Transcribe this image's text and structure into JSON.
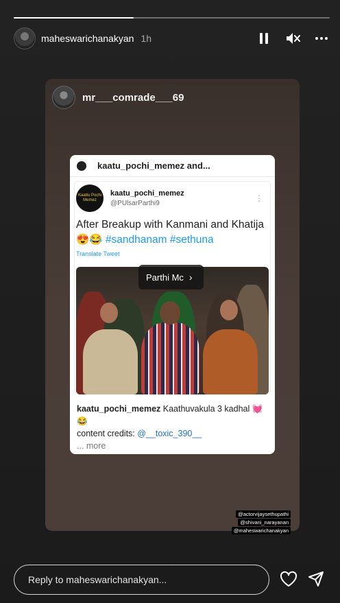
{
  "story": {
    "progress": 0.38,
    "username": "maheswarichanakyan",
    "time": "1h"
  },
  "header_icons": [
    "pause-icon",
    "mute-icon",
    "more-icon"
  ],
  "shared": {
    "username": "mr___comrade___69"
  },
  "post": {
    "top_title": "kaatu_pochi_memez and...",
    "tweet": {
      "avatar_text": "Kaattu Pochi Memez",
      "name": "kaatu_pochi_memez",
      "handle": "@PUlsarParthi9",
      "text_main": "After Breakup with Kanmani and Khatija😍😂",
      "text_tags": "#sandhanam #sethuna",
      "translate": "Translate Tweet"
    },
    "caption": {
      "user": "kaatu_pochi_memez",
      "text": "Kaathuvakula 3 kadhal 💓😂",
      "credits_label": "content credits:",
      "credits_link": "@__toxic_390__",
      "more": "... more"
    }
  },
  "tag_popup": {
    "label": "Parthi Mc",
    "chevron": "›"
  },
  "mentions": [
    "@actorvijaysethupathi",
    "@shivani_narayanan",
    "@maheswarichanakyan"
  ],
  "reply": {
    "placeholder": "Reply to maheswarichanakyan..."
  },
  "footer_icons": [
    "heart-icon",
    "send-icon"
  ]
}
